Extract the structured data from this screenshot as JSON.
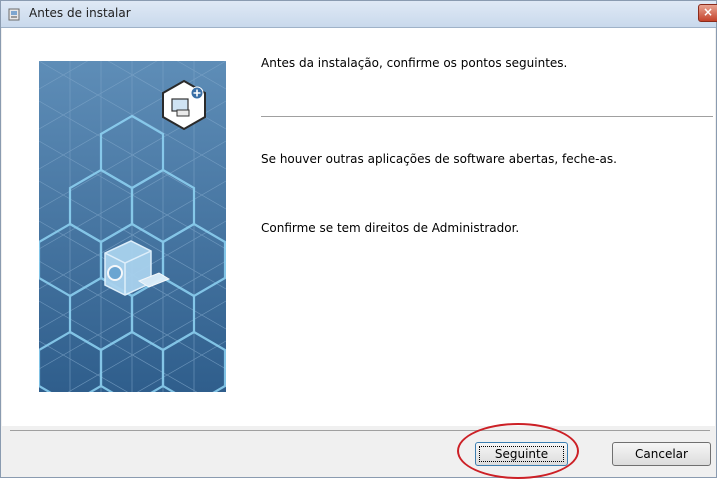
{
  "window": {
    "title": "Antes de instalar",
    "close_symbol": "×",
    "icon": "installer-icon"
  },
  "content": {
    "heading": "Antes da instalação, confirme os pontos seguintes.",
    "point_1": "Se houver outras aplicações de software abertas, feche-as.",
    "point_2": "Confirme se tem direitos de Administrador."
  },
  "buttons": {
    "next_label": "Seguinte",
    "cancel_label": "Cancelar"
  },
  "colors": {
    "highlight_ring": "#cc2026",
    "art_background": "#3f6f9a",
    "hex_line": "#8fd4f4"
  }
}
